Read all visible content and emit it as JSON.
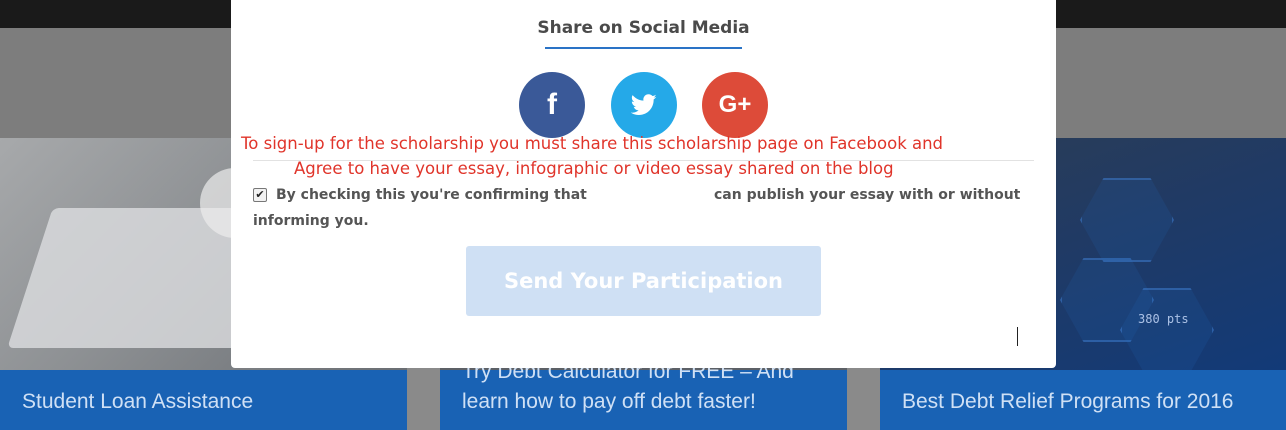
{
  "modal": {
    "share_title": "Share on Social Media",
    "social": [
      {
        "name": "Facebook",
        "glyph": "f",
        "color": "#3a5998",
        "icon": "facebook-icon"
      },
      {
        "name": "Twitter",
        "color": "#25a9e8",
        "icon": "twitter-icon"
      },
      {
        "name": "Google Plus",
        "glyph": "G+",
        "color": "#dd4b39",
        "icon": "google-plus-icon"
      }
    ],
    "notice_line1": "To sign-up for the scholarship you must share this scholarship page on Facebook and",
    "notice_line2": "Agree to have your essay, infographic or video essay shared on the blog",
    "confirm_part1": "By checking this you're confirming that",
    "confirm_part2": "can publish your essay with or without",
    "confirm_part3": "informing you.",
    "checkbox_checked": true,
    "submit_label": "Send Your Participation",
    "submit_color": "#cfe0f4"
  },
  "background_cards": [
    {
      "title": "Student Loan Assistance"
    },
    {
      "title": "Try Debt Calculator for FREE – And learn how to pay off debt faster!"
    },
    {
      "title": "Best Debt Relief Programs for 2016"
    }
  ],
  "decor": {
    "hex_label": "380 pts"
  },
  "colors": {
    "accent": "#2a73c6",
    "notice": "#e0342a",
    "card_band": "#1962b4"
  }
}
